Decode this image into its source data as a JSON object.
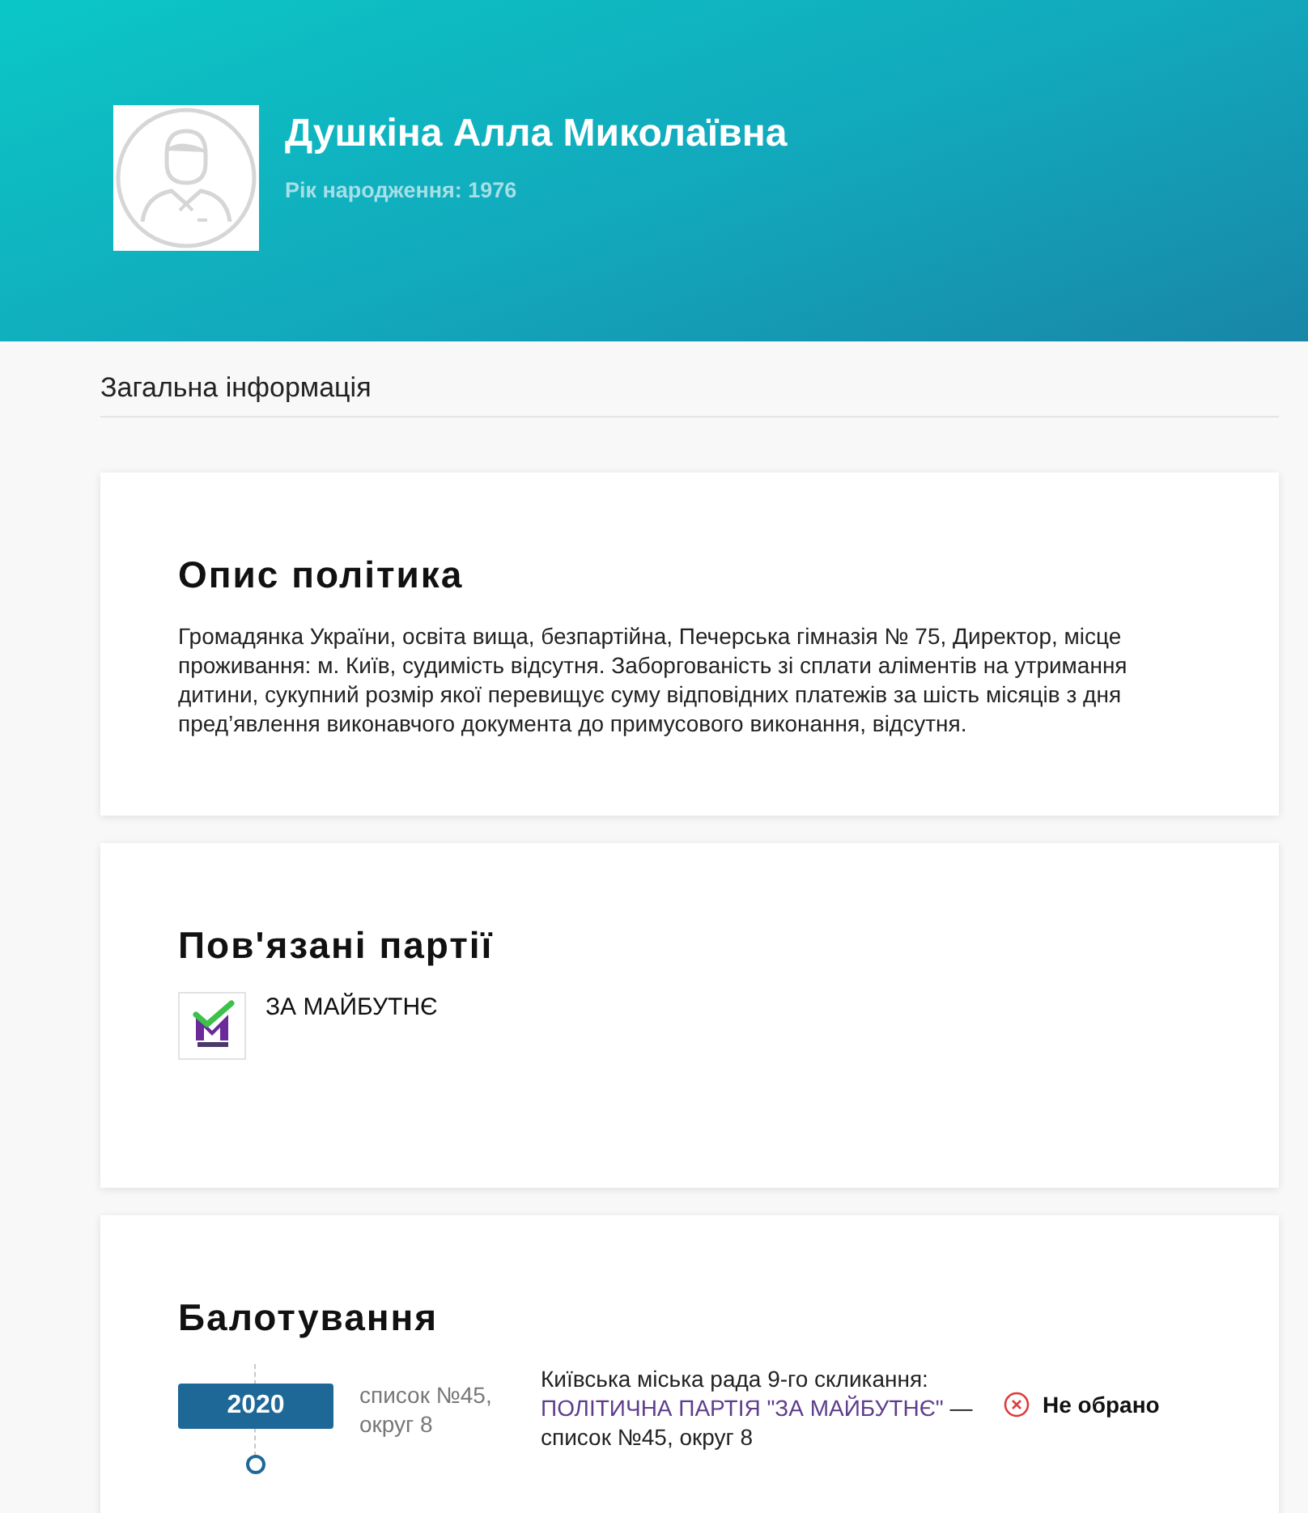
{
  "profile": {
    "name": "Душкіна Алла Миколаївна",
    "birth_year": "Рік народження: 1976"
  },
  "section_title": "Загальна інформація",
  "description": {
    "title": "Опис політика",
    "text": "Громадянка України, освіта вища, безпартійна, Печерська гімназія № 75, Директор, місце проживання: м. Київ, судимість відсутня. Заборгованість зі сплати аліментів на утримання дитини, сукупний розмір якої перевищує суму відповідних платежів за шість місяців з дня пред’явлення виконавчого документа до примусового виконання, відсутня."
  },
  "parties": {
    "title": "Пов'язані партії",
    "items": [
      {
        "name": "ЗА МАЙБУТНЄ"
      }
    ]
  },
  "elections": {
    "title": "Балотування",
    "items": [
      {
        "year": "2020",
        "list": "список №45, округ 8",
        "council": "Київська міська рада 9-го скликання:",
        "party": "ПОЛІТИЧНА ПАРТІЯ \"ЗА МАЙБУТНЄ\"",
        "suffix": "— список №45, округ 8",
        "result": "Не обрано",
        "elected": false
      }
    ]
  }
}
